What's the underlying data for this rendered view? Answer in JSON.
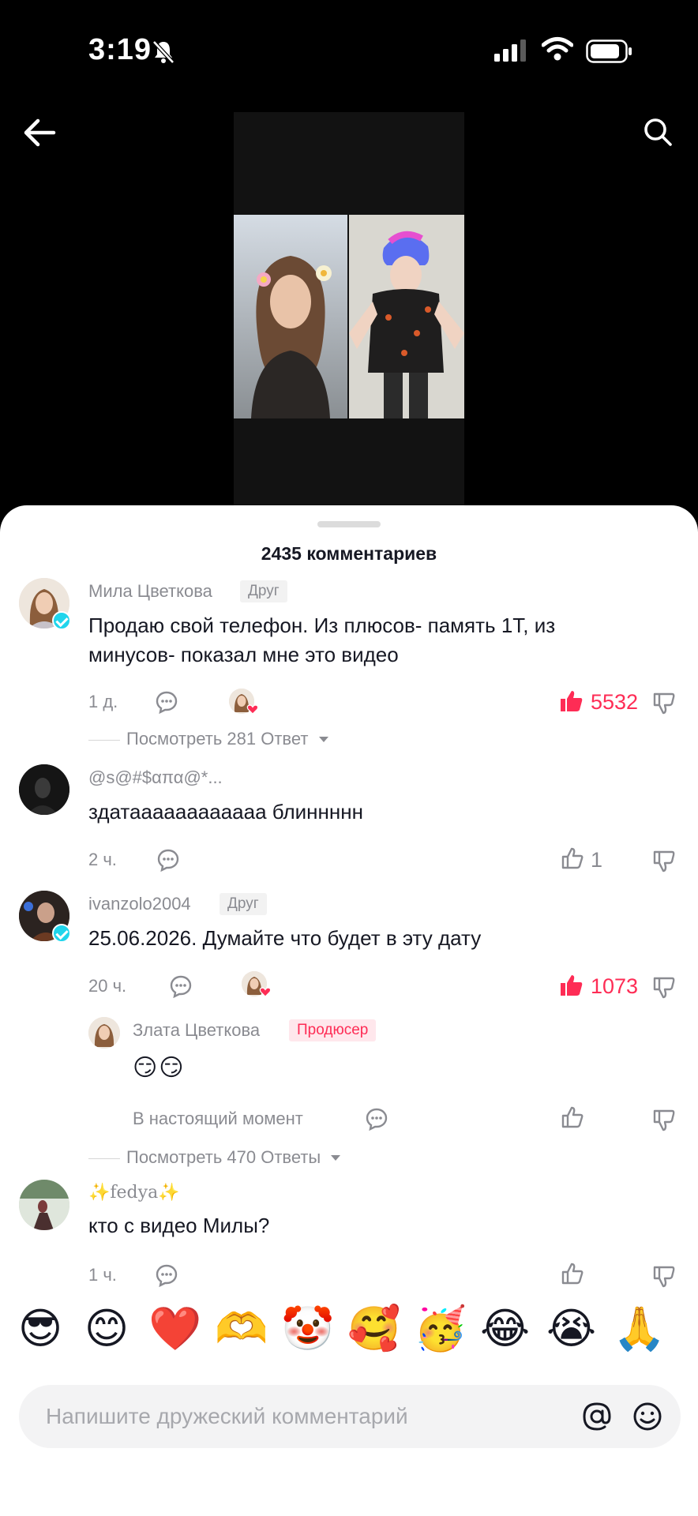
{
  "status_bar": {
    "time": "3:19"
  },
  "comments_header": {
    "count_label": "2435 комментариев"
  },
  "comments": [
    {
      "username": "Мила Цветкова",
      "badge": "Друг",
      "text_lines": [
        "Продаю свой телефон. Из плюсов- память 1Т, из",
        "минусов- показал мне это видео"
      ],
      "time": "1 д.",
      "likes": "5532",
      "view_replies": "Посмотреть 281 Ответ"
    },
    {
      "username": "@s@#$απα@*...",
      "text_lines": [
        "здатаааааааааааа блиннннн"
      ],
      "time": "2 ч.",
      "likes": "1"
    },
    {
      "username": "ivanzolo2004",
      "badge": "Друг",
      "text_lines": [
        "25.06.2026. Думайте что будет в эту дату"
      ],
      "time": "20 ч.",
      "likes": "1073",
      "view_replies": "Посмотреть 470 Ответы"
    },
    {
      "username": "✨fedya✨",
      "text_lines": [
        "кто с видео Милы?"
      ],
      "time": "1 ч."
    }
  ],
  "reply": {
    "username": "Злата Цветкова",
    "badge": "Продюсер",
    "text": "😏😏",
    "time": "В настоящий момент"
  },
  "quick_emojis": [
    "😎",
    "😊",
    "❤️",
    "🫶",
    "🤡",
    "🥰",
    "🥳",
    "😂",
    "😭",
    "🙏"
  ],
  "composer": {
    "placeholder": "Напишите дружеский комментарий"
  },
  "colors": {
    "accent": "#fe2c55",
    "verified": "#20d5ec"
  }
}
